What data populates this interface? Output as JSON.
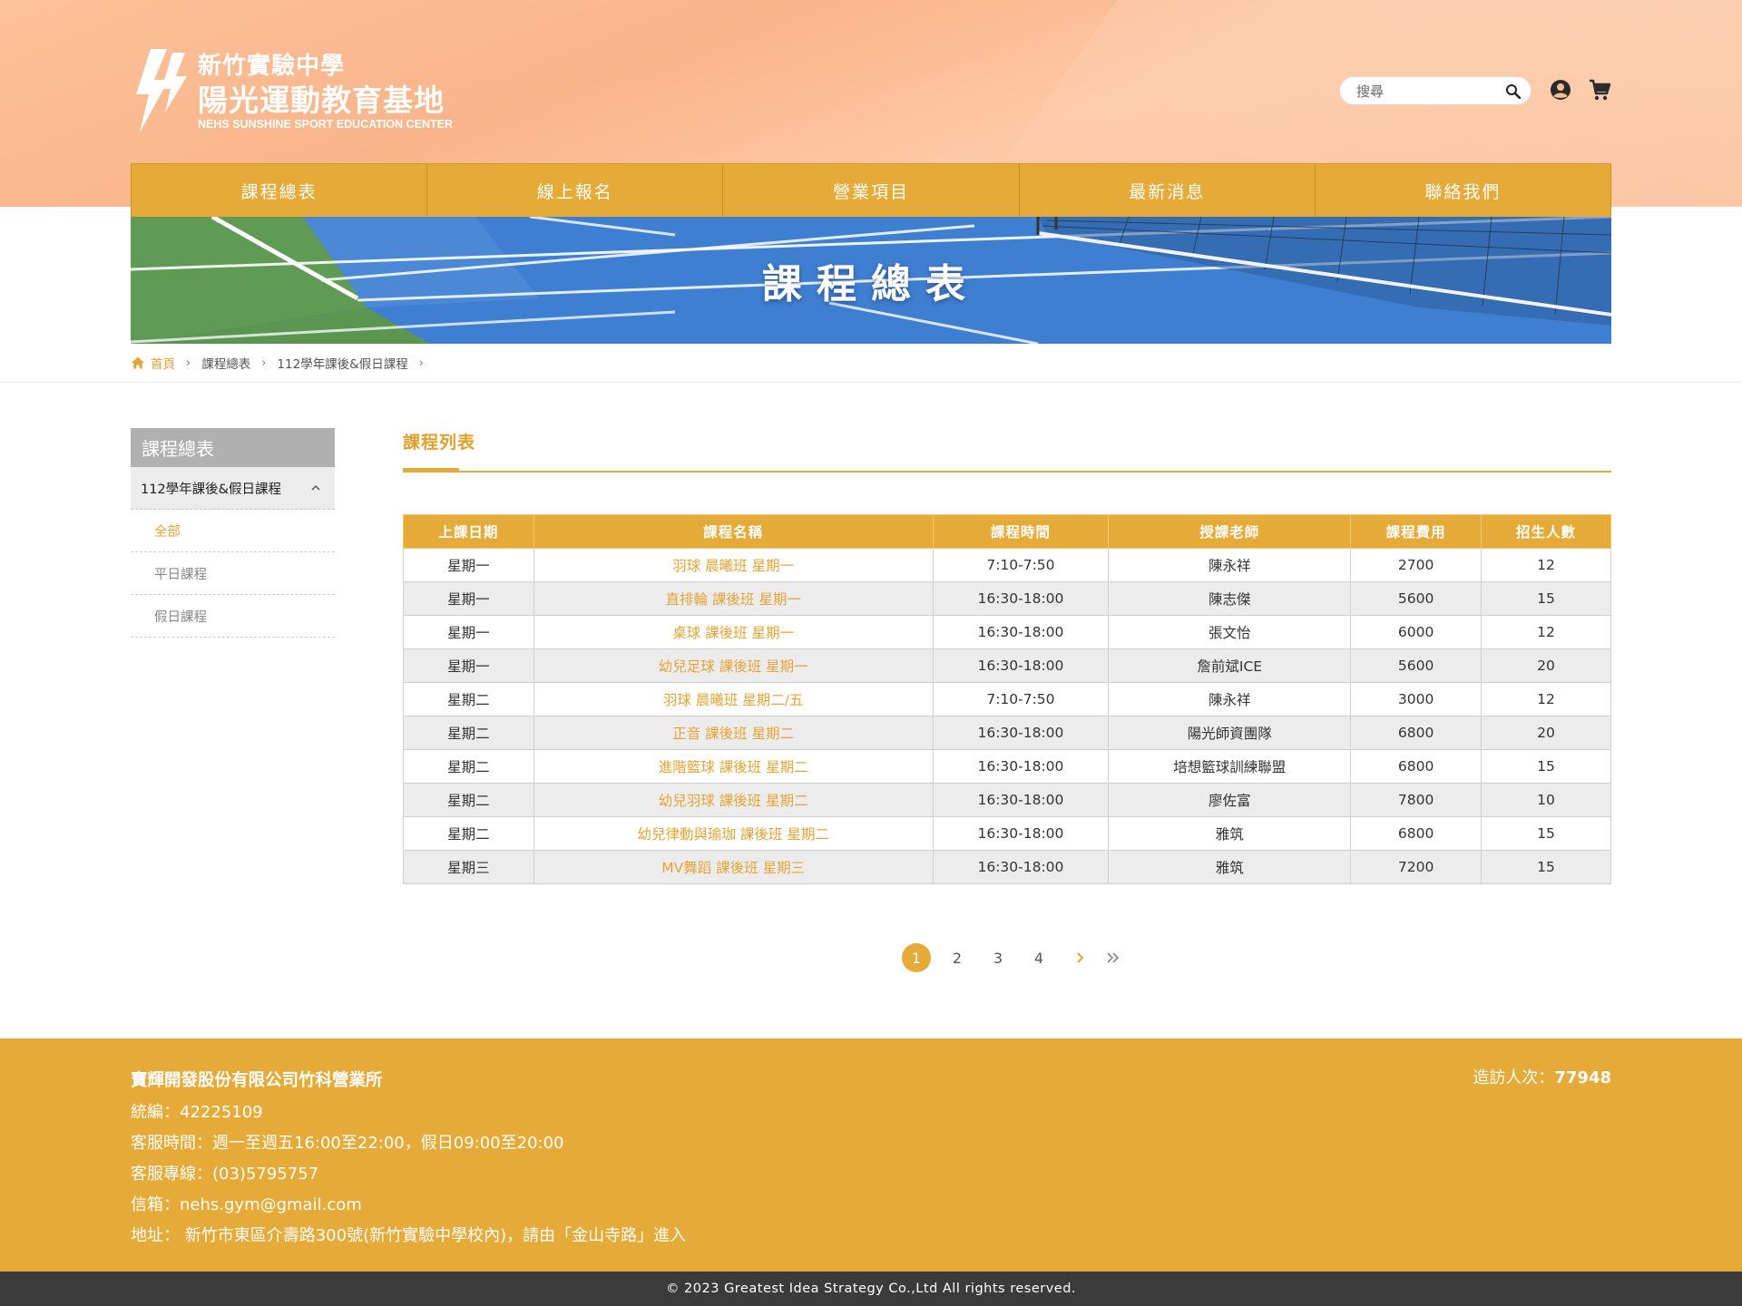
{
  "brand": {
    "line1": "新竹實驗中學",
    "line2": "陽光運動教育基地",
    "line3": "NEHS SUNSHINE SPORT EDUCATION CENTER"
  },
  "search": {
    "placeholder": "搜尋"
  },
  "nav": {
    "items": [
      {
        "label": "課程總表"
      },
      {
        "label": "線上報名"
      },
      {
        "label": "營業項目"
      },
      {
        "label": "最新消息"
      },
      {
        "label": "聯絡我們"
      }
    ]
  },
  "banner": {
    "title": "課程總表"
  },
  "breadcrumb": {
    "home": "首頁",
    "level1": "課程總表",
    "level2": "112學年課後&假日課程"
  },
  "sidebar": {
    "title": "課程總表",
    "group": "112學年課後&假日課程",
    "items": [
      {
        "label": "全部",
        "active": true
      },
      {
        "label": "平日課程",
        "active": false
      },
      {
        "label": "假日課程",
        "active": false
      }
    ]
  },
  "main": {
    "section_title": "課程列表",
    "table": {
      "headers": [
        "上課日期",
        "課程名稱",
        "課程時間",
        "授課老師",
        "課程費用",
        "招生人數"
      ],
      "rows": [
        [
          "星期一",
          "羽球 晨曦班 星期一",
          "7:10-7:50",
          "陳永祥",
          "2700",
          "12"
        ],
        [
          "星期一",
          "直排輪 課後班 星期一",
          "16:30-18:00",
          "陳志傑",
          "5600",
          "15"
        ],
        [
          "星期一",
          "桌球 課後班 星期一",
          "16:30-18:00",
          "張文怡",
          "6000",
          "12"
        ],
        [
          "星期一",
          "幼兒足球 課後班 星期一",
          "16:30-18:00",
          "詹前斌ICE",
          "5600",
          "20"
        ],
        [
          "星期二",
          "羽球 晨曦班 星期二/五",
          "7:10-7:50",
          "陳永祥",
          "3000",
          "12"
        ],
        [
          "星期二",
          "正音 課後班 星期二",
          "16:30-18:00",
          "陽光師資團隊",
          "6800",
          "20"
        ],
        [
          "星期二",
          "進階籃球 課後班 星期二",
          "16:30-18:00",
          "培想籃球訓練聯盟",
          "6800",
          "15"
        ],
        [
          "星期二",
          "幼兒羽球 課後班 星期二",
          "16:30-18:00",
          "廖佐富",
          "7800",
          "10"
        ],
        [
          "星期二",
          "幼兒律動與瑜珈 課後班 星期二",
          "16:30-18:00",
          "雅筑",
          "6800",
          "15"
        ],
        [
          "星期三",
          "MV舞蹈 課後班 星期三",
          "16:30-18:00",
          "雅筑",
          "7200",
          "15"
        ]
      ]
    },
    "pagination": {
      "pages": [
        "1",
        "2",
        "3",
        "4"
      ],
      "current": "1"
    }
  },
  "footer": {
    "company": "寶輝開發股份有限公司竹科營業所",
    "tax_id": "統編：42225109",
    "hours": "客服時間：週一至週五16:00至22:00，假日09:00至20:00",
    "phone": "客服專線：(03)5795757",
    "email": "信箱：nehs.gym@gmail.com",
    "address": "地址： 新竹市東區介壽路300號(新竹實驗中學校內)，請由「金山寺路」進入",
    "visitors_label": "造訪人次：",
    "visitors_count": "77948",
    "copyright": "© 2023 Greatest Idea Strategy Co.,Ltd All rights reserved."
  },
  "colors": {
    "accent": "#e6aa38",
    "header_peach": "#fbbf98",
    "court_blue": "#3d7bd0",
    "court_green": "#5e9a52",
    "copyright_bar": "#3b3b3b"
  },
  "icons": [
    "search-icon",
    "user-icon",
    "cart-icon",
    "home-icon",
    "chevron-right-icon",
    "chevron-up-icon",
    "double-chevron-right-icon"
  ]
}
